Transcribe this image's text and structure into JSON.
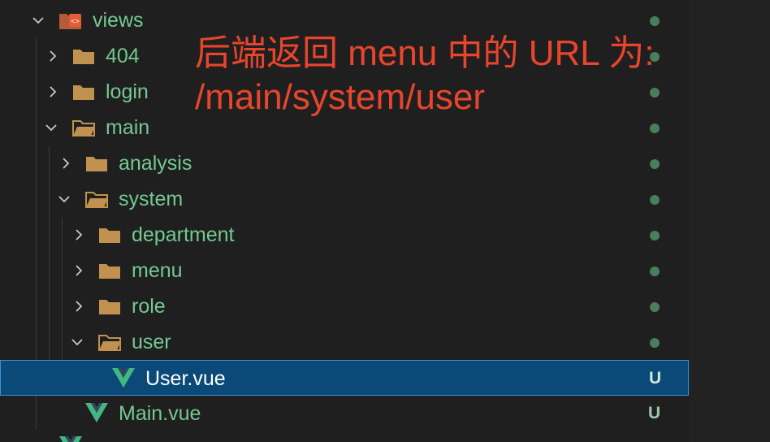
{
  "annotation": {
    "line1": "后端返回 menu 中的 URL 为:",
    "line2": "/main/system/user"
  },
  "colors": {
    "tree_background": "#1f1f1f",
    "folder_label": "#73c991",
    "selected_background": "#0b4a78",
    "annotation_text": "#e8452c",
    "status_dot": "#4a7d5b"
  },
  "tree": {
    "items": [
      {
        "label": "views",
        "type": "views-folder",
        "expanded": true,
        "status": "dot"
      },
      {
        "label": "404",
        "type": "folder",
        "expanded": false,
        "status": "dot"
      },
      {
        "label": "login",
        "type": "folder",
        "expanded": false,
        "status": "dot"
      },
      {
        "label": "main",
        "type": "folder-open",
        "expanded": true,
        "status": "dot"
      },
      {
        "label": "analysis",
        "type": "folder",
        "expanded": false,
        "status": "dot"
      },
      {
        "label": "system",
        "type": "folder-open",
        "expanded": true,
        "status": "dot"
      },
      {
        "label": "department",
        "type": "folder",
        "expanded": false,
        "status": "dot"
      },
      {
        "label": "menu",
        "type": "folder",
        "expanded": false,
        "status": "dot"
      },
      {
        "label": "role",
        "type": "folder",
        "expanded": false,
        "status": "dot"
      },
      {
        "label": "user",
        "type": "folder-open",
        "expanded": true,
        "status": "dot"
      },
      {
        "label": "User.vue",
        "type": "vue-file",
        "selected": true,
        "status": "U"
      },
      {
        "label": "Main.vue",
        "type": "vue-file",
        "status": "U"
      }
    ]
  }
}
